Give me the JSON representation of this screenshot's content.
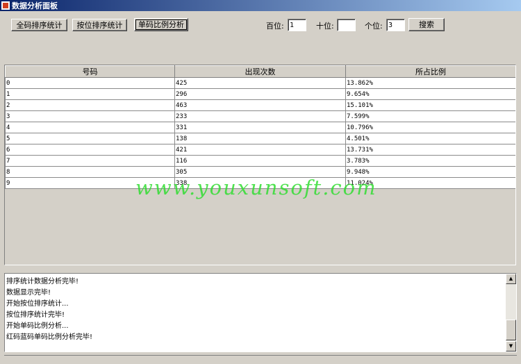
{
  "window": {
    "title": "数据分析面板"
  },
  "toolbar": {
    "btn_full_sort": "全码排序统计",
    "btn_pos_sort": "按位排序统计",
    "btn_single_ratio": "单码比例分析",
    "label_hundreds": "百位:",
    "value_hundreds": "1",
    "label_tens": "十位:",
    "value_tens": "",
    "label_ones": "个位:",
    "value_ones": "3",
    "btn_search": "搜索"
  },
  "table": {
    "headers": [
      "号码",
      "出现次数",
      "所占比例"
    ],
    "rows": [
      [
        "0",
        "425",
        "13.862%"
      ],
      [
        "1",
        "296",
        "9.654%"
      ],
      [
        "2",
        "463",
        "15.101%"
      ],
      [
        "3",
        "233",
        "7.599%"
      ],
      [
        "4",
        "331",
        "10.796%"
      ],
      [
        "5",
        "138",
        "4.501%"
      ],
      [
        "6",
        "421",
        "13.731%"
      ],
      [
        "7",
        "116",
        "3.783%"
      ],
      [
        "8",
        "305",
        "9.948%"
      ],
      [
        "9",
        "338",
        "11.024%"
      ]
    ]
  },
  "watermark": "www.youxunsoft.com",
  "log": {
    "lines": [
      "排序统计数据分析完毕!",
      "数据显示完毕!",
      "开始按位排序统计...",
      "按位排序统计完毕!",
      "开始单码比例分析...",
      "红码蓝码单码比例分析完毕!"
    ]
  }
}
